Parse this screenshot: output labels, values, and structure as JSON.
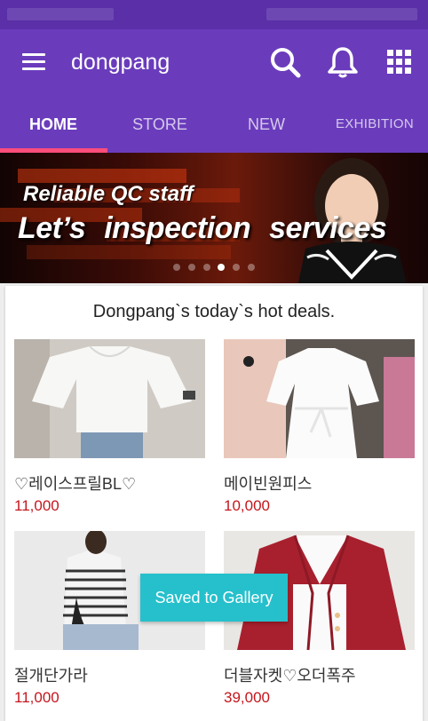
{
  "app": {
    "title": "dongpang"
  },
  "appbar": {
    "icons": [
      "menu-icon",
      "search-icon",
      "bell-icon",
      "apps-grid-icon"
    ]
  },
  "tabs": [
    {
      "label": "HOME",
      "active": true
    },
    {
      "label": "STORE",
      "active": false
    },
    {
      "label": "NEW",
      "active": false
    },
    {
      "label": "EXHIBITION",
      "active": false
    }
  ],
  "banner": {
    "line1": "Reliable QC staff",
    "line2": "Let’s inspection services",
    "slide_count": 6,
    "active_slide": 3
  },
  "deals": {
    "title": "Dongpang`s today`s hot deals.",
    "products": [
      {
        "name": "♡레이스프릴BL♡",
        "price": "11,000"
      },
      {
        "name": "메이빈원피스",
        "price": "10,000"
      },
      {
        "name": "절개단가라",
        "price": "11,000"
      },
      {
        "name": "더블자켓♡오더폭주",
        "price": "39,000"
      }
    ]
  },
  "toast": {
    "text": "Saved to Gallery"
  },
  "colors": {
    "appbar": "#6a3cbc",
    "statusbar": "#5a2fa8",
    "tab_indicator": "#ff4d7a",
    "price": "#c4161c",
    "toast": "#25c0cc"
  }
}
